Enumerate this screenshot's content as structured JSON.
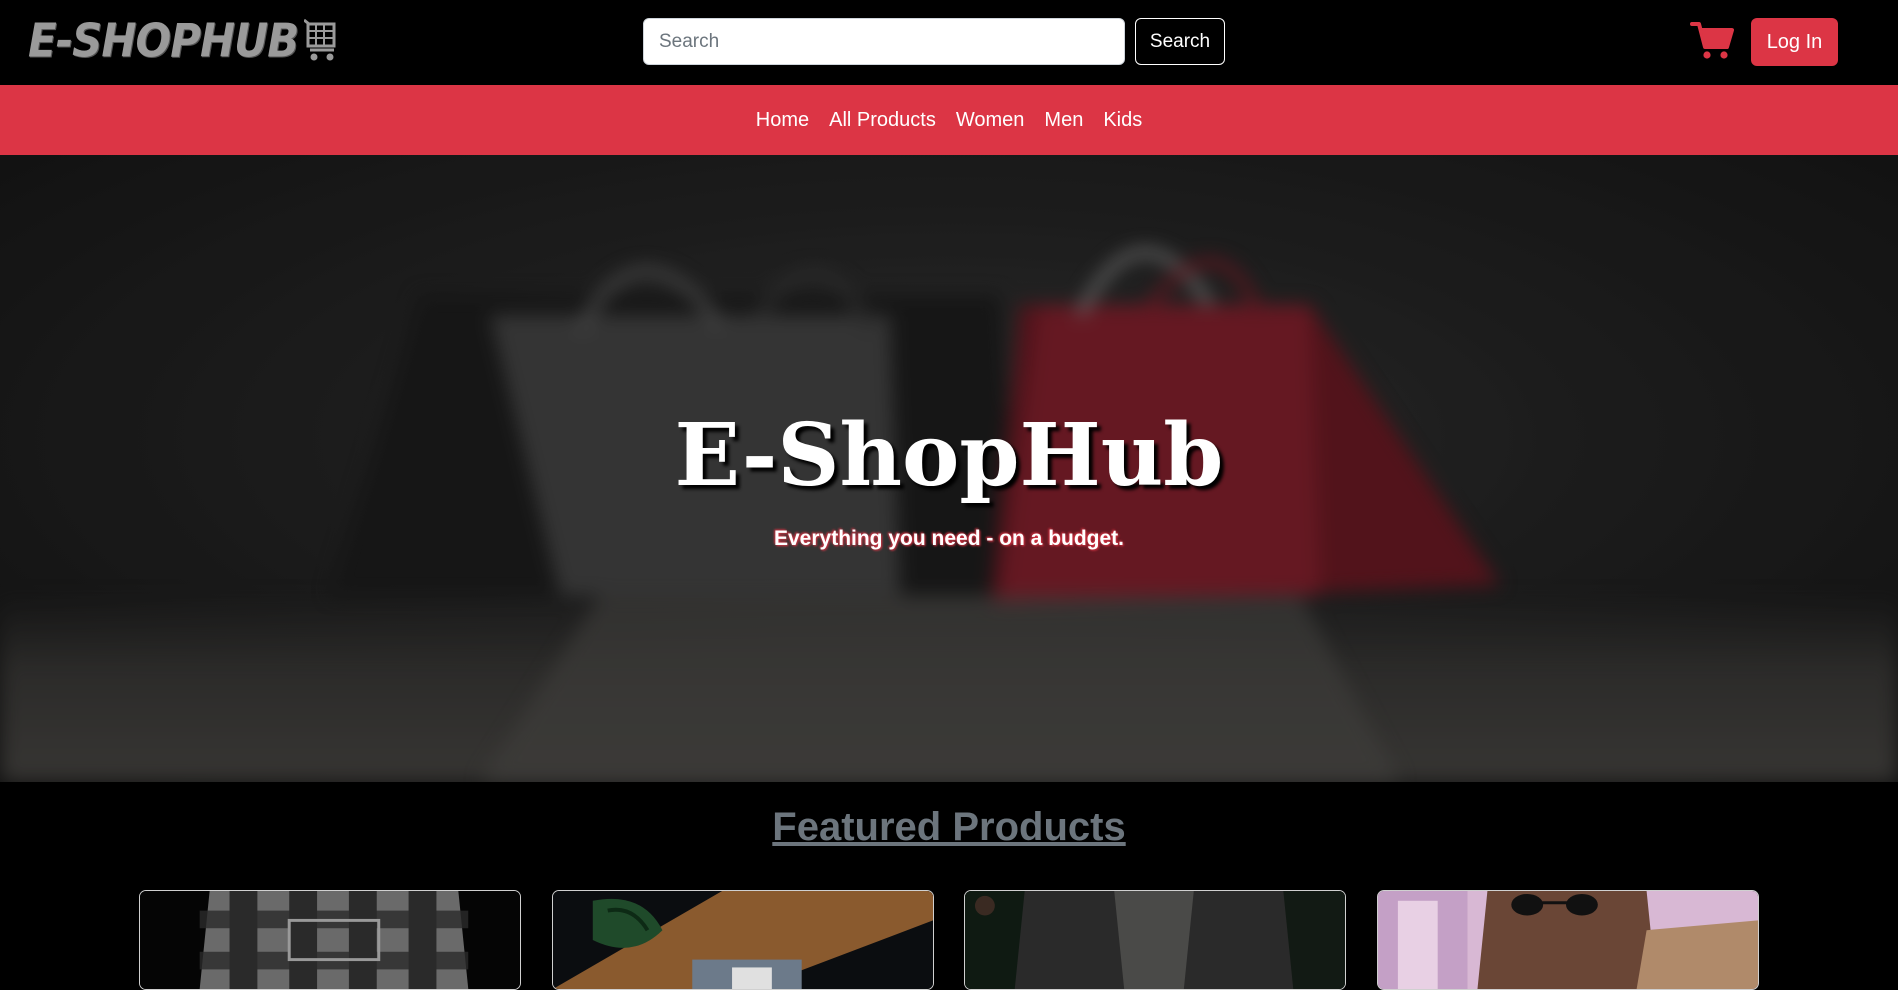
{
  "header": {
    "logo_text": "E-SHOPHUB",
    "logo_icon": "shopping-cart-icon",
    "search_placeholder": "Search",
    "search_button": "Search",
    "cart_icon": "cart-icon",
    "login_button": "Log In"
  },
  "nav": {
    "items": [
      {
        "label": "Home"
      },
      {
        "label": "All Products"
      },
      {
        "label": "Women"
      },
      {
        "label": "Men"
      },
      {
        "label": "Kids"
      }
    ]
  },
  "hero": {
    "title": "E-ShopHub",
    "subtitle": "Everything you need - on a budget."
  },
  "featured": {
    "title": "Featured Products",
    "cards": [
      {
        "image": "plaid-shirt-image"
      },
      {
        "image": "folded-clothes-with-plant-image"
      },
      {
        "image": "dark-jacket-image"
      },
      {
        "image": "man-with-sunglasses-image"
      }
    ]
  },
  "colors": {
    "accent": "#dc3545",
    "background": "#000000",
    "muted": "#6c757d"
  }
}
